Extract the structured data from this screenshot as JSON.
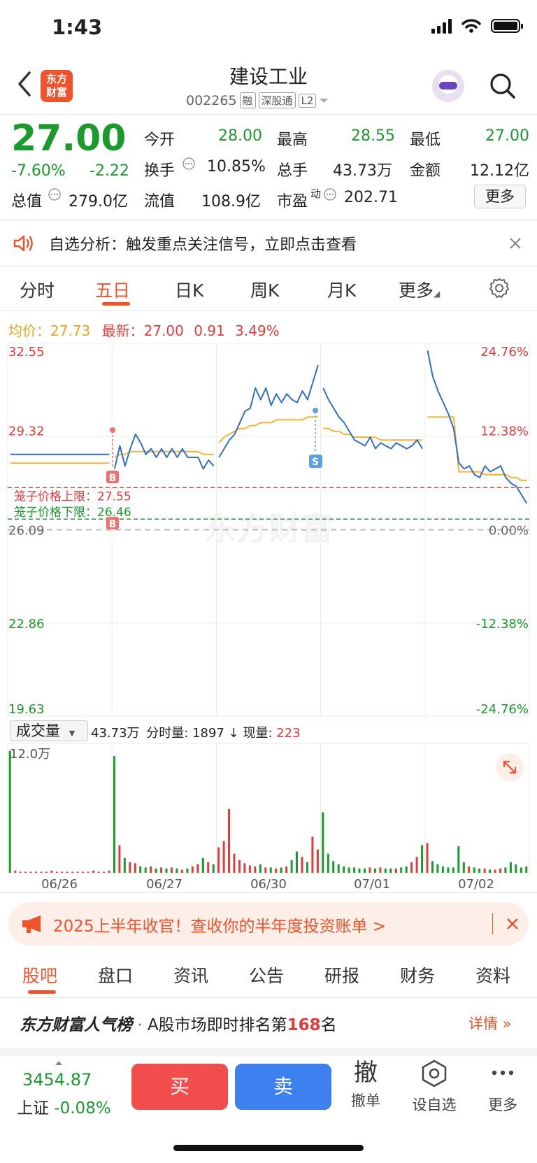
{
  "status_bar": {
    "time": "1:43"
  },
  "header": {
    "title": "建设工业",
    "code": "002265",
    "tags": [
      "融",
      "深股通",
      "L2"
    ],
    "logo_text": [
      "东方",
      "财富"
    ]
  },
  "quote": {
    "price": "27.00",
    "change_pct": "-7.60%",
    "change": "-2.22",
    "open_label": "今开",
    "open": "28.00",
    "high_label": "最高",
    "high": "28.55",
    "low_label": "最低",
    "low": "27.00",
    "turnover_label": "换手",
    "turnover": "10.85%",
    "volume_label": "总手",
    "volume": "43.73万",
    "amount_label": "金额",
    "amount": "12.12亿",
    "mktcap_label": "总值",
    "mktcap": "279.0亿",
    "float_label": "流值",
    "float": "108.9亿",
    "pe_label": "市盈",
    "pe_sup": "动",
    "pe": "202.71",
    "more_label": "更多"
  },
  "notice": {
    "text": "自选分析：触发重点关注信号，立即点击查看"
  },
  "chart_tabs": [
    "分时",
    "五日",
    "日K",
    "周K",
    "月K",
    "更多"
  ],
  "chart_legend": {
    "avg_label": "均价：",
    "avg": "27.73",
    "latest_label": "最新：",
    "latest": "27.00",
    "latest_chg": "0.91",
    "latest_pct": "3.49%"
  },
  "chart_labels": {
    "cage_upper": "笼子价格上限：27.55",
    "cage_lower": "笼子价格下限：26.46",
    "marker_b": "B",
    "marker_s": "S",
    "vol_max": "12.0万"
  },
  "volume_bar": {
    "selector": "成交量",
    "total": "43.73万",
    "tick_label": "分时量:",
    "tick_val": "1897",
    "now_label": "现量:",
    "now_val": "223"
  },
  "chart_data": {
    "type": "line",
    "title": "",
    "x_dates": [
      "06/26",
      "06/27",
      "06/30",
      "07/01",
      "07/02"
    ],
    "y_left": [
      "32.55",
      "29.32",
      "26.09",
      "22.86",
      "19.63"
    ],
    "y_right": [
      "24.76%",
      "12.38%",
      "0.00%",
      "-12.38%",
      "-24.76%"
    ],
    "ylim": [
      19.63,
      32.55
    ],
    "prev_close": 26.09,
    "cage_upper": 27.55,
    "cage_lower": 26.46,
    "series": [
      {
        "values": [
          28.7,
          28.7,
          28.7,
          28.7,
          28.7,
          28.7,
          28.7,
          28.7,
          28.7,
          28.7,
          28.7,
          28.7,
          28.7,
          28.7,
          28.7,
          28.7,
          28.7,
          28.7,
          28.7,
          28.7,
          28.2,
          29.0,
          28.3,
          28.9,
          29.4,
          29.1,
          28.7,
          28.9,
          28.6,
          28.9,
          28.6,
          28.9,
          28.6,
          28.9,
          28.6,
          28.6,
          28.6,
          28.2,
          28.5,
          28.3,
          28.6,
          28.9,
          29.2,
          29.4,
          29.8,
          30.2,
          30.3,
          31.0,
          30.6,
          31.0,
          30.4,
          30.8,
          30.5,
          30.8,
          30.6,
          30.5,
          30.9,
          30.6,
          31.2,
          31.8,
          31.0,
          30.6,
          30.3,
          30.0,
          29.8,
          29.5,
          29.2,
          29.1,
          29.0,
          29.3,
          28.9,
          29.1,
          29.0,
          28.9,
          29.1,
          29.0,
          28.9,
          29.0,
          29.2,
          28.9,
          32.3,
          31.4,
          30.9,
          30.5,
          30.1,
          29.6,
          28.4,
          28.2,
          28.3,
          28.0,
          27.9,
          28.3,
          28.1,
          28.2,
          28.3,
          27.9,
          27.7,
          27.6,
          27.3,
          27.0
        ]
      },
      {
        "values": [
          28.4,
          28.4,
          28.4,
          28.4,
          28.4,
          28.4,
          28.4,
          28.4,
          28.4,
          28.4,
          28.4,
          28.4,
          28.4,
          28.4,
          28.4,
          28.4,
          28.4,
          28.4,
          28.4,
          28.4,
          28.6,
          28.7,
          28.7,
          28.8,
          28.8,
          28.8,
          28.8,
          28.8,
          28.8,
          28.8,
          28.8,
          28.8,
          28.8,
          28.8,
          28.8,
          28.8,
          28.8,
          28.7,
          28.7,
          28.7,
          29.1,
          29.3,
          29.4,
          29.5,
          29.6,
          29.6,
          29.7,
          29.7,
          29.8,
          29.8,
          29.8,
          29.9,
          29.9,
          29.9,
          29.9,
          29.9,
          29.9,
          30.0,
          30.0,
          30.0,
          29.6,
          29.6,
          29.5,
          29.5,
          29.4,
          29.4,
          29.3,
          29.3,
          29.3,
          29.3,
          29.3,
          29.2,
          29.2,
          29.2,
          29.2,
          29.2,
          29.2,
          29.2,
          29.2,
          29.2,
          30.0,
          30.0,
          30.0,
          30.0,
          30.0,
          30.0,
          28.1,
          28.1,
          28.1,
          28.1,
          28.1,
          28.0,
          28.0,
          28.0,
          28.0,
          28.0,
          27.9,
          27.9,
          27.8,
          27.8
        ]
      }
    ],
    "volume": [
      11.5,
      0.2,
      0.1,
      0.1,
      0.1,
      0.1,
      0.1,
      0.1,
      0.2,
      0.1,
      0.1,
      0.1,
      0.1,
      0.1,
      0.1,
      0.1,
      0.2,
      0.1,
      0.1,
      0.2,
      11.0,
      2.6,
      1.4,
      1.0,
      0.9,
      0.6,
      0.5,
      0.6,
      0.4,
      0.5,
      0.4,
      0.5,
      0.4,
      0.3,
      0.4,
      0.6,
      0.8,
      1.4,
      1.0,
      0.8,
      2.4,
      3.0,
      6.0,
      1.8,
      1.2,
      0.9,
      0.7,
      0.6,
      0.8,
      0.5,
      0.5,
      0.4,
      0.5,
      0.6,
      1.2,
      2.0,
      1.5,
      1.0,
      3.4,
      2.2,
      5.7,
      1.8,
      1.1,
      0.8,
      0.6,
      0.5,
      0.5,
      0.4,
      0.4,
      0.5,
      0.4,
      0.5,
      0.4,
      0.4,
      0.4,
      0.5,
      0.6,
      1.0,
      1.5,
      2.6,
      2.8,
      1.1,
      0.8,
      0.6,
      0.5,
      0.5,
      2.5,
      1.0,
      0.6,
      0.5,
      0.4,
      0.4,
      0.3,
      0.3,
      0.4,
      0.5,
      1.0,
      0.8,
      0.5,
      0.6
    ],
    "volume_max": 12.0
  },
  "banner": {
    "text": "2025上半年收官！查收你的半年度投资账单"
  },
  "bottom_tabs": [
    "股吧",
    "盘口",
    "资讯",
    "公告",
    "研报",
    "财务",
    "资料"
  ],
  "rank": {
    "brand": "东方财富人气榜",
    "text_pre": "A股市场即时排名第",
    "rank": "168",
    "text_post": "名",
    "link": "详情"
  },
  "bottom_bar": {
    "index_value": "3454.87",
    "index_name": "上证",
    "index_change": "-0.08%",
    "buy": "买",
    "sell": "卖",
    "cancel_icon": "撤",
    "cancel": "撤单",
    "watchlist": "设自选",
    "more": "更多"
  },
  "colors": {
    "up": "#e23b3b",
    "down": "#1a9a2c",
    "accent": "#f0532c",
    "price_line": "#2f6fc8",
    "avg_line": "#f5b335"
  }
}
